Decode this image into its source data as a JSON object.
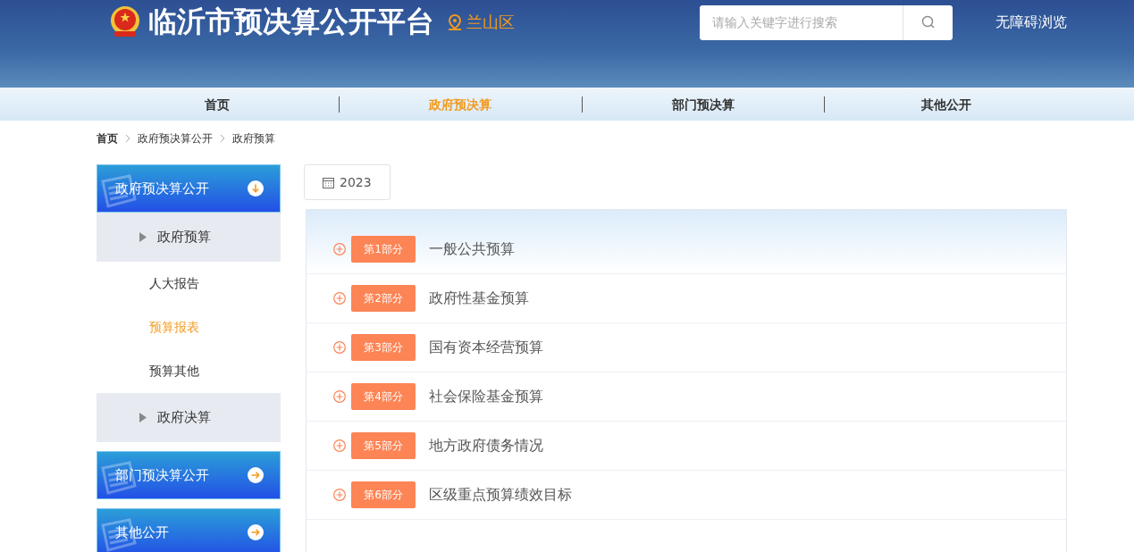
{
  "header": {
    "title": "临沂市预决算公开平台",
    "region": "兰山区",
    "search": {
      "placeholder": "请输入关键字进行搜索"
    },
    "accessibility": "无障碍浏览"
  },
  "nav": [
    {
      "label": "首页",
      "selected": false
    },
    {
      "label": "政府预决算",
      "selected": true
    },
    {
      "label": "部门预决算",
      "selected": false
    },
    {
      "label": "其他公开",
      "selected": false
    }
  ],
  "breadcrumb": [
    "首页",
    "政府预决算公开",
    "政府预算"
  ],
  "sidebar": [
    {
      "label": "政府预决算公开",
      "expanded": true,
      "children": [
        {
          "label": "政府预算",
          "expanded": true,
          "children": [
            {
              "label": "人大报告",
              "selected": false
            },
            {
              "label": "预算报表",
              "selected": true
            },
            {
              "label": "预算其他",
              "selected": false
            }
          ]
        },
        {
          "label": "政府决算",
          "expanded": false
        }
      ]
    },
    {
      "label": "部门预决算公开",
      "expanded": false
    },
    {
      "label": "其他公开",
      "expanded": false
    }
  ],
  "year": "2023",
  "parts": [
    {
      "badge": "第1部分",
      "title": "一般公共预算"
    },
    {
      "badge": "第2部分",
      "title": "政府性基金预算"
    },
    {
      "badge": "第3部分",
      "title": "国有资本经营预算"
    },
    {
      "badge": "第4部分",
      "title": "社会保险基金预算"
    },
    {
      "badge": "第5部分",
      "title": "地方政府债务情况"
    },
    {
      "badge": "第6部分",
      "title": "区级重点预算绩效目标"
    }
  ]
}
